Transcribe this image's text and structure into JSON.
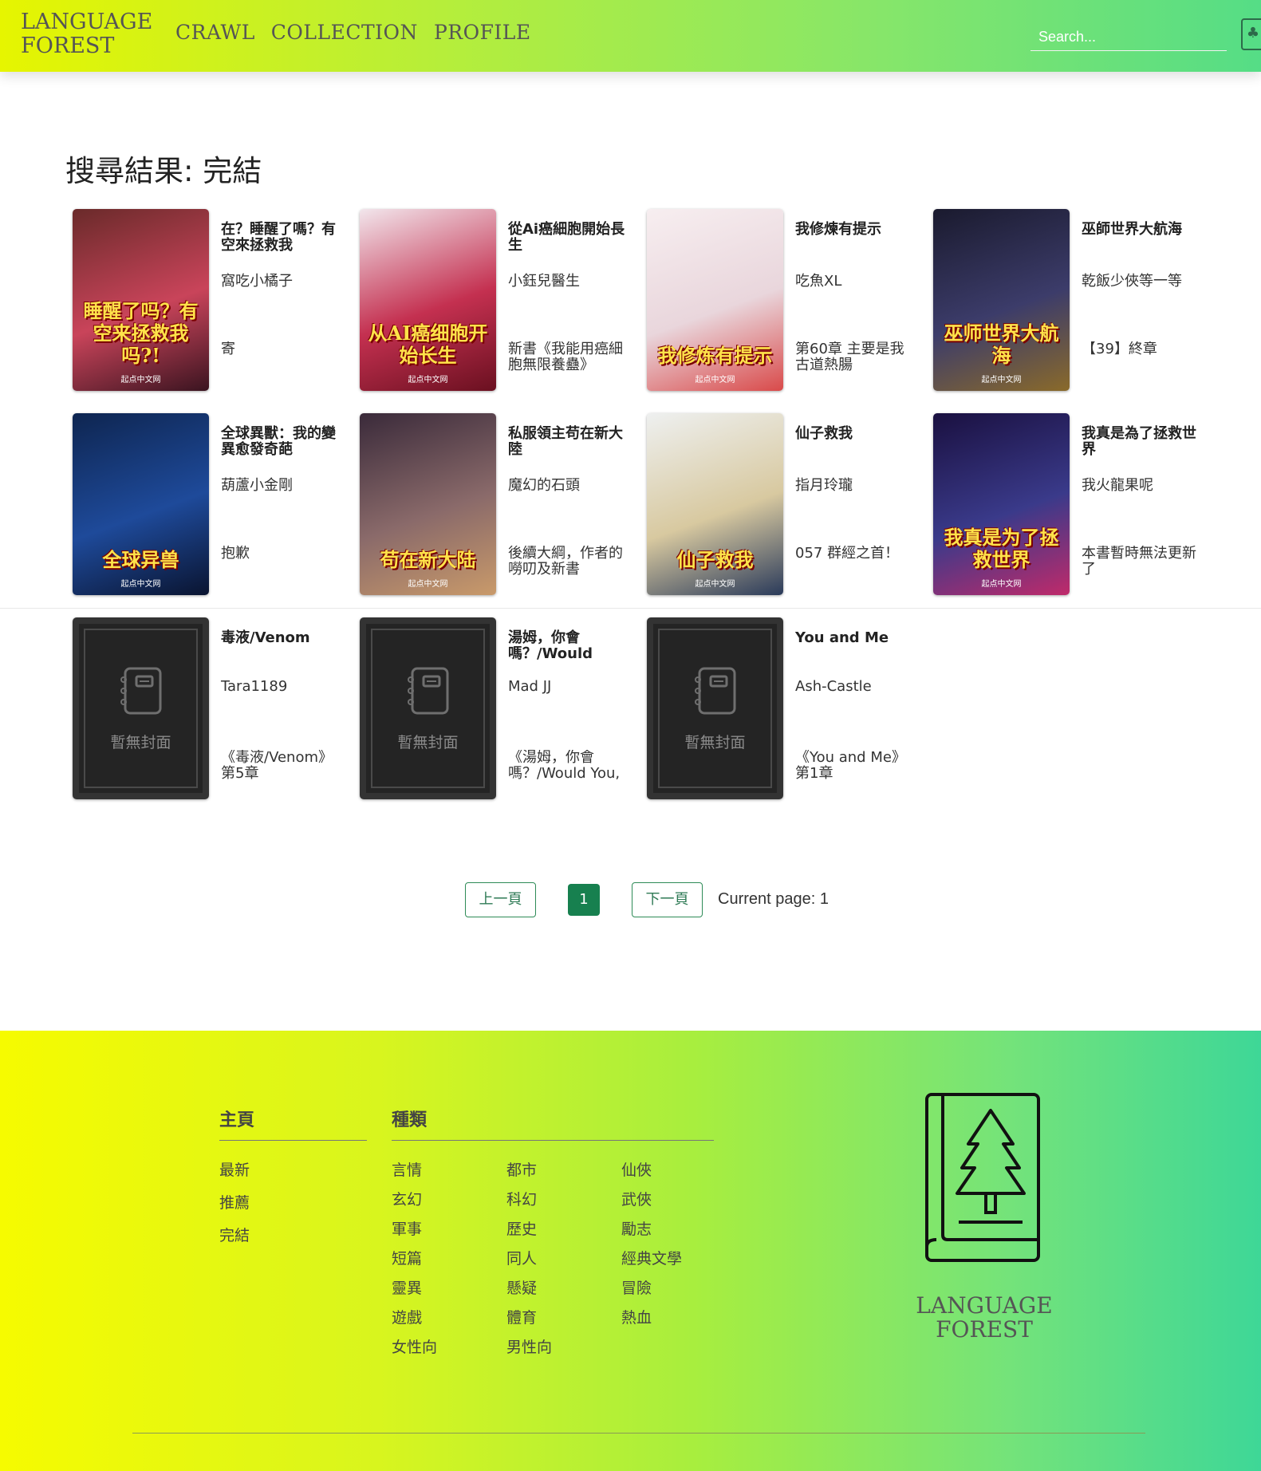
{
  "header": {
    "logo_line1": "LANGUAGE",
    "logo_line2": "FOREST",
    "nav": [
      "CRAWL",
      "COLLECTION",
      "PROFILE"
    ],
    "search_placeholder": "Search..."
  },
  "results": {
    "title": "搜尋結果: 完結",
    "books": [
      {
        "title": "在？睡醒了嗎？有空來拯救我",
        "author": "窩吃小橘子",
        "chapter": "寄",
        "cover_text": "睡醒了吗？有空来拯救我吗?!",
        "cover_colors": [
          "#6a2a2a",
          "#c9445a",
          "#3a1420"
        ],
        "has_cover": true
      },
      {
        "title": "從Ai癌細胞開始長生",
        "author": "小鈺兒醫生",
        "chapter": "新書《我能用癌細胞無限養蠱》",
        "cover_text": "从AI癌细胞开始长生",
        "cover_colors": [
          "#f2e6ec",
          "#c43050",
          "#6a1020"
        ],
        "has_cover": true
      },
      {
        "title": "我修煉有提示",
        "author": "吃魚XL",
        "chapter": "第60章 主要是我古道熱腸",
        "cover_text": "我修炼有提示",
        "cover_colors": [
          "#f7eef0",
          "#e9d6dc",
          "#d94a4a"
        ],
        "has_cover": true
      },
      {
        "title": "巫師世界大航海",
        "author": "乾飯少俠等一等",
        "chapter": "【39】終章",
        "cover_text": "巫师世界大航海",
        "cover_colors": [
          "#1a1a2e",
          "#3c3c6a",
          "#8a6a2a"
        ],
        "has_cover": true
      },
      {
        "title": "全球異獸：我的變異愈發奇葩",
        "author": "葫蘆小金剛",
        "chapter": "抱歉",
        "cover_text": "全球异兽",
        "cover_colors": [
          "#0e2550",
          "#1e4a9a",
          "#0a1430"
        ],
        "has_cover": true
      },
      {
        "title": "私服領主苟在新大陸",
        "author": "魔幻的石頭",
        "chapter": "後續大綱，作者的嘮叨及新書",
        "cover_text": "苟在新大陆",
        "cover_colors": [
          "#3a2a3a",
          "#8a6a6a",
          "#c99a6a"
        ],
        "has_cover": true
      },
      {
        "title": "仙子救我",
        "author": "指月玲瓏",
        "chapter": "057 群經之首！",
        "cover_text": "仙子救我",
        "cover_colors": [
          "#eef0f0",
          "#d8c9a0",
          "#2a3a5a"
        ],
        "has_cover": true
      },
      {
        "title": "我真是為了拯救世界",
        "author": "我火龍果呢",
        "chapter": "本書暫時無法更新了",
        "cover_text": "我真是为了拯救世界",
        "cover_colors": [
          "#1a1040",
          "#3a3a8a",
          "#c02a6a"
        ],
        "has_cover": true
      },
      {
        "title": "毒液/Venom",
        "author": "Tara1189",
        "chapter": "《毒液/Venom》第5章",
        "has_cover": false
      },
      {
        "title": "湯姆，你會嗎？/Would",
        "author": "Mad JJ",
        "chapter": "《湯姆，你會嗎？/Would You,",
        "has_cover": false
      },
      {
        "title": "You and Me",
        "author": "Ash-Castle",
        "chapter": "《You and Me》第1章",
        "has_cover": false
      }
    ],
    "no_cover_label": "暫無封面",
    "cover_publisher": "起点中文网"
  },
  "pagination": {
    "prev": "上一頁",
    "current": "1",
    "next": "下一頁",
    "status": "Current page: 1"
  },
  "footer": {
    "home_heading": "主頁",
    "home_links": [
      "最新",
      "推薦",
      "完結"
    ],
    "genre_heading": "種類",
    "genre_col1": [
      "言情",
      "玄幻",
      "軍事",
      "短篇",
      "靈異",
      "遊戲",
      "女性向"
    ],
    "genre_col2": [
      "都市",
      "科幻",
      "歷史",
      "同人",
      "懸疑",
      "體育",
      "男性向"
    ],
    "genre_col3": [
      "仙俠",
      "武俠",
      "勵志",
      "經典文學",
      "冒險",
      "熱血"
    ],
    "logo_line1": "LANGUAGE",
    "logo_line2": "FOREST"
  }
}
